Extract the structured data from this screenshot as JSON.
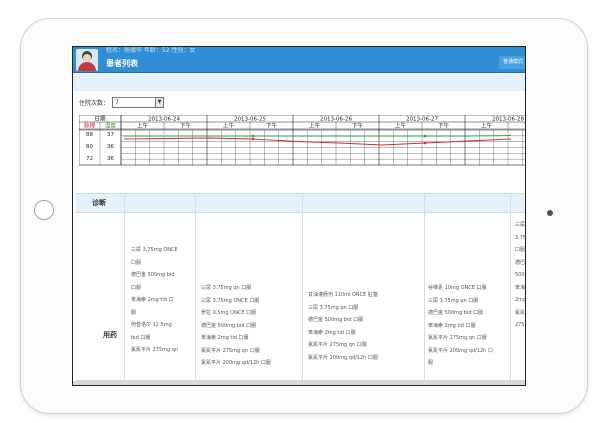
{
  "header": {
    "patient_info": "姓名：杨德华 年龄：52 性别：女",
    "title": "患者列表",
    "standard_button": "普通模式"
  },
  "stay": {
    "label": "住院次数：",
    "value": "7"
  },
  "vitals": {
    "date_header": "日期",
    "pulse_label": "脉搏",
    "temp_label": "温度",
    "dates": [
      "2013-06-24",
      "2013-06-25",
      "2013-06-26",
      "2013-06-27",
      "2013-06-28",
      "2013-06"
    ],
    "am_label": "上午",
    "pm_label": "下午",
    "pulse_scale": [
      "88",
      "80",
      "72"
    ],
    "temp_scale": [
      "37",
      "36",
      "36"
    ],
    "colors": {
      "pulse": "#d9262b",
      "temp": "#2e9a3c",
      "grid": "#222222"
    }
  },
  "table": {
    "diagnosis_label": "诊断",
    "medication_label": "用药",
    "columns": [
      [
        "三尿 3.75mg ONCE",
        "口服",
        "德巴金 500mg bid",
        "口服",
        "苯海索 2mg tid 口",
        "服",
        "阿替洛尔 12.5mg",
        "bid 口服",
        "氯氮平片 275mg qn"
      ],
      [
        "三尿 3.75mg qn 口服",
        "三尿 3.75mg ONCE 口服",
        "罗拉 0.5mg ONCE 口服",
        "德巴金 500mg bid 口服",
        "苯海索 2mg tid 口服",
        "氯氮平片 275mg qn 口服",
        "氯氮平片 200mg qd/12h 口服"
      ],
      [
        "甘油灌肠剂 110ml ONCE 肛塞",
        "三尿 3.75mg qn 口服",
        "德巴金 500mg bid 口服",
        "苯海索 2mg tid 口服",
        "氯氮平片 275mg qn 口服",
        "氯氮平片 200mg qd/12h 口服"
      ],
      [
        "谷维素 10mg ONCE 口服",
        "三尿 3.75mg qn 口服",
        "德巴金 500mg bid 口服",
        "苯海索 2mg tid 口服",
        "氯氮平片 275mg qn 口服",
        "氯氮平片 200mg qd/12h 口",
        "服"
      ],
      [
        "三尿",
        "3.75",
        "口服",
        "德巴",
        "500m",
        "苯海",
        "2mg",
        "氯氮",
        "275"
      ]
    ]
  }
}
